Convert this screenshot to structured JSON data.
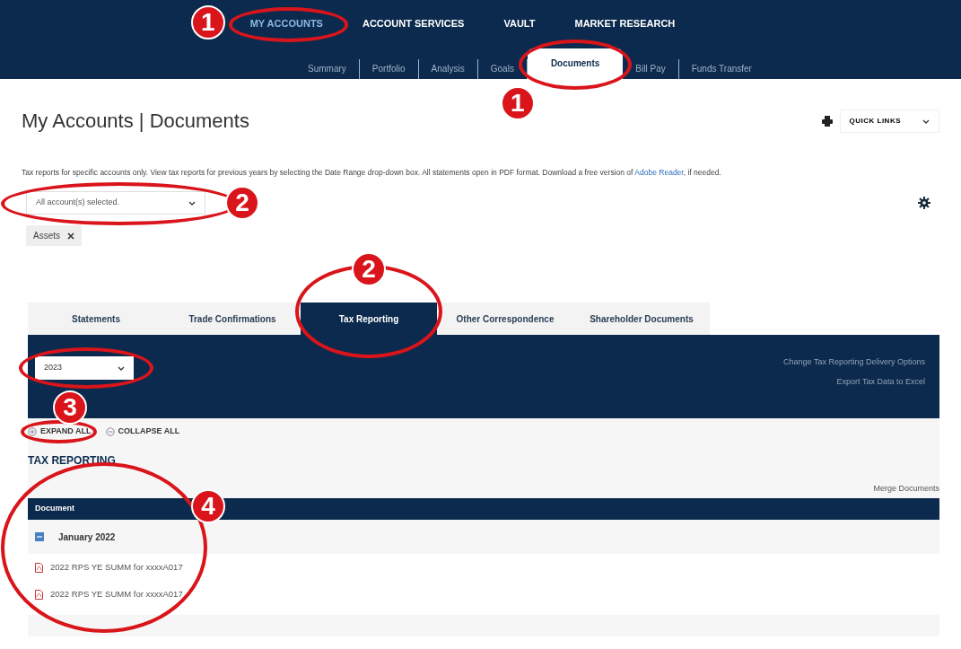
{
  "top_nav": [
    {
      "label": "MY ACCOUNTS",
      "selected": true,
      "callout": {
        "circled": true,
        "number": "1"
      }
    },
    {
      "label": "ACCOUNT SERVICES",
      "selected": false
    },
    {
      "label": "VAULT",
      "selected": false
    },
    {
      "label": "MARKET RESEARCH",
      "selected": false
    }
  ],
  "sub_nav": [
    {
      "label": "Summary",
      "selected": false
    },
    {
      "label": "Portfolio",
      "selected": false
    },
    {
      "label": "Analysis",
      "selected": false
    },
    {
      "label": "Goals",
      "selected": false
    },
    {
      "label": "Documents",
      "selected": true,
      "callout": {
        "circled": true,
        "number": "1"
      }
    },
    {
      "label": "Bill Pay",
      "selected": false
    },
    {
      "label": "Funds Transfer",
      "selected": false
    }
  ],
  "page_title": "My Accounts | Documents",
  "quick_links": "QUICK LINKS",
  "intro": {
    "text": "Tax reports for specific accounts only. View tax reports for previous years by selecting the Date Range drop-down box. All statements open in PDF format. Download a free version of ",
    "link": "Adobe Reader",
    "after": ", if needed."
  },
  "account_filter": {
    "value": "All account(s) selected.",
    "callout": {
      "circled": true,
      "number": "2"
    }
  },
  "chips": [
    {
      "label": "Assets"
    }
  ],
  "doc_tabs": [
    {
      "label": "Statements",
      "selected": false
    },
    {
      "label": "Trade Confirmations",
      "selected": false
    },
    {
      "label": "Tax Reporting",
      "selected": true,
      "callout": {
        "circled": true,
        "number": "2"
      }
    },
    {
      "label": "Other Correspondence",
      "selected": false
    },
    {
      "label": "Shareholder Documents",
      "selected": false
    }
  ],
  "year_select": {
    "value": "2023",
    "callout": {
      "circled": true,
      "number": "3"
    }
  },
  "panel_links": [
    "Change Tax Reporting Delivery Options",
    "Export Tax Data to Excel"
  ],
  "expand_controls": [
    {
      "kind": "expand",
      "label": "EXPAND ALL",
      "callout": {
        "circled": true
      }
    },
    {
      "kind": "collapse",
      "label": "COLLAPSE ALL"
    }
  ],
  "section_title": "TAX REPORTING",
  "merge_link": "Merge Documents",
  "table": {
    "columns": [
      "Document"
    ],
    "callout": {
      "circled": true,
      "number": "4"
    },
    "groups": [
      {
        "label": "January 2022",
        "expanded": true,
        "rows": [
          {
            "name": "2022 RPS YE SUMM for xxxxA017"
          },
          {
            "name": "2022 RPS YE SUMM for xxxxA017"
          }
        ]
      }
    ]
  }
}
